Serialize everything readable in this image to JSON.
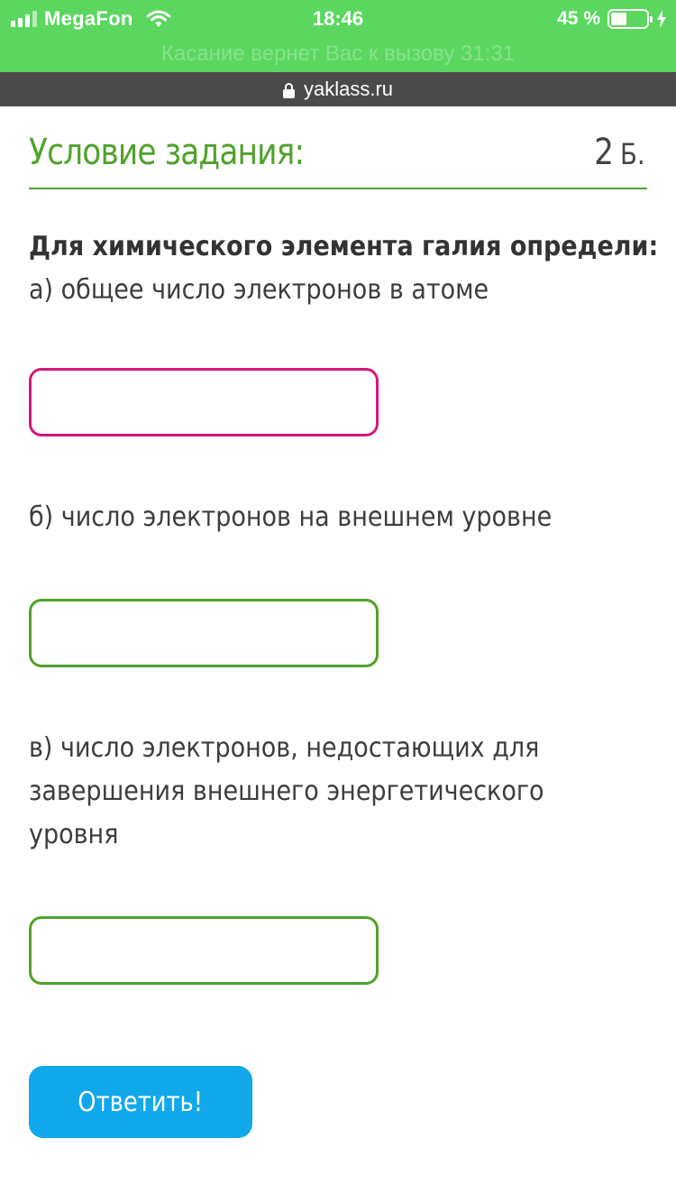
{
  "status_bar": {
    "carrier": "MegaFon",
    "time": "18:46",
    "battery": "45 %",
    "battery_level_percent": 45,
    "icons": [
      "signal-icon",
      "wifi-icon",
      "battery-icon",
      "charging-bolt-icon"
    ],
    "call_banner": "Касание вернет Вас к вызову 31:31",
    "background_color": "#5bd760"
  },
  "browser": {
    "url": "yaklass.ru",
    "icon": "lock-icon"
  },
  "task": {
    "title": "Условие задания:",
    "points_value": "2",
    "points_unit": "Б.",
    "accent_color": "#4fa22a",
    "question_bold": "Для химического элемента галия определи:",
    "part_a": "а) общее число электронов в атоме",
    "part_b": "б) число электронов на внешнем уровне",
    "part_c_line1": "в) число электронов, недостающих для",
    "part_c_line2": "завершения внешнего энергетического",
    "part_c_line3": "уровня",
    "inputs": [
      {
        "value": "",
        "state": "focused",
        "border_color": "#d4187c"
      },
      {
        "value": "",
        "state": "default",
        "border_color": "#4fa22a"
      },
      {
        "value": "",
        "state": "default",
        "border_color": "#4fa22a"
      }
    ]
  },
  "submit": {
    "label": "Ответить!",
    "color": "#10a8ea"
  }
}
